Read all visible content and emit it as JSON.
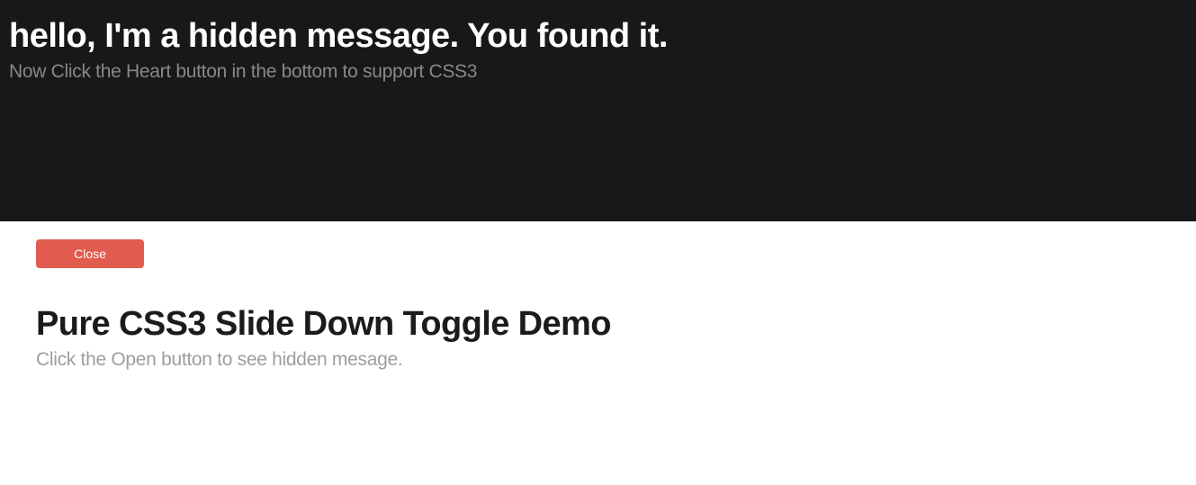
{
  "hidden_panel": {
    "title": "hello, I'm a hidden message. You found it.",
    "subtitle": "Now Click the Heart button in the bottom to support CSS3"
  },
  "toggle_button": {
    "label": "Close"
  },
  "main": {
    "title": "Pure CSS3 Slide Down Toggle Demo",
    "subtitle": "Click the Open button to see hidden mesage."
  }
}
